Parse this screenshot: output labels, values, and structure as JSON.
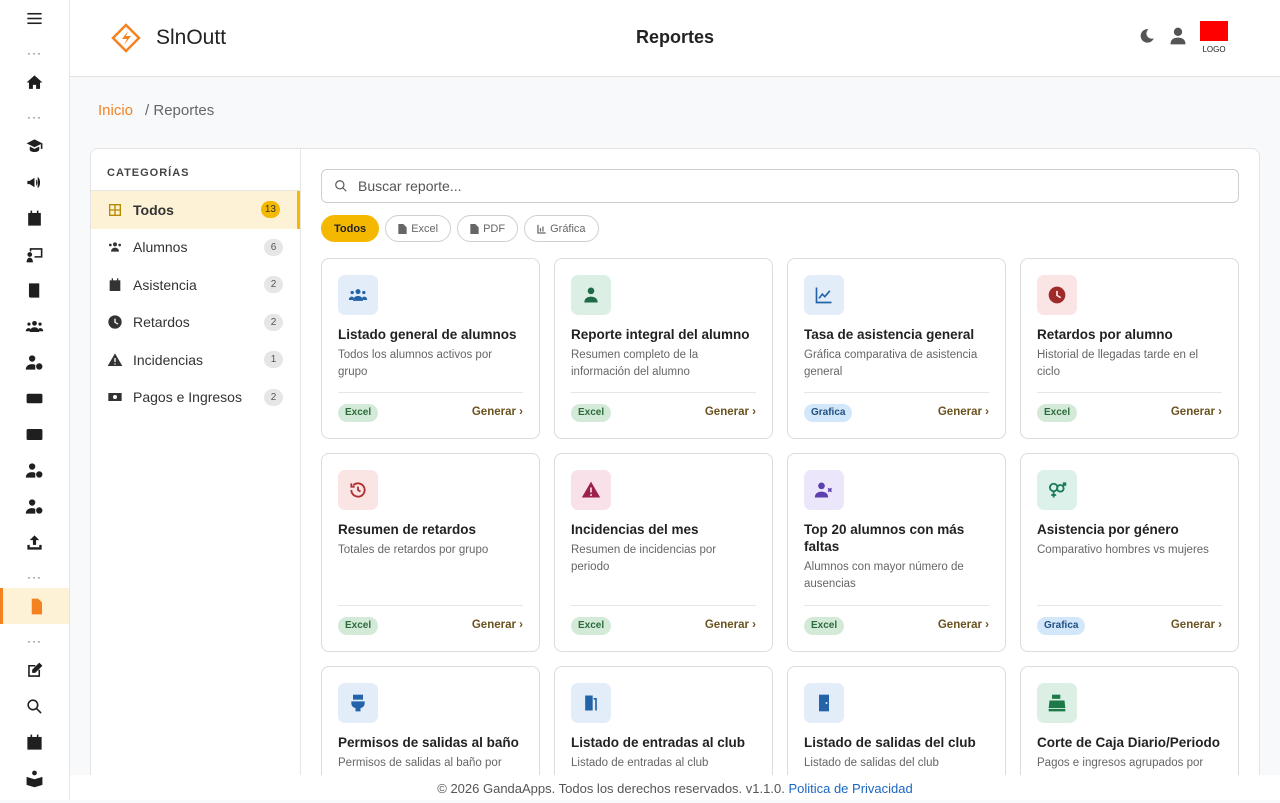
{
  "brand": {
    "name": "SlnOutt"
  },
  "page": {
    "title": "Reportes"
  },
  "logo": {
    "text": "LOGO",
    "color": "#ff0000"
  },
  "breadcrumb": {
    "home": "Inicio",
    "current": "/ Reportes"
  },
  "categories": {
    "title": "CATEGORÍAS",
    "items": [
      {
        "label": "Todos",
        "count": "13",
        "icon": "grid-icon"
      },
      {
        "label": "Alumnos",
        "count": "6",
        "icon": "users-icon"
      },
      {
        "label": "Asistencia",
        "count": "2",
        "icon": "calendar-check-icon"
      },
      {
        "label": "Retardos",
        "count": "2",
        "icon": "clock-icon"
      },
      {
        "label": "Incidencias",
        "count": "1",
        "icon": "warning-icon"
      },
      {
        "label": "Pagos e Ingresos",
        "count": "2",
        "icon": "money-icon"
      }
    ]
  },
  "search": {
    "placeholder": "Buscar reporte..."
  },
  "filters": [
    "Todos",
    "Excel",
    "PDF",
    "Gráfica"
  ],
  "cards": [
    {
      "title": "Listado general de alumnos",
      "desc": "Todos los alumnos activos por grupo",
      "badge": "Excel",
      "action": "Generar ›",
      "icon": "users-icon"
    },
    {
      "title": "Reporte integral del alumno",
      "desc": "Resumen completo de la información del alumno",
      "badge": "Excel",
      "action": "Generar ›",
      "icon": "user-icon"
    },
    {
      "title": "Tasa de asistencia general",
      "desc": "Gráfica comparativa de asistencia general",
      "badge": "Grafica",
      "action": "Generar ›",
      "icon": "line-chart-icon"
    },
    {
      "title": "Retardos por alumno",
      "desc": "Historial de llegadas tarde en el ciclo",
      "badge": "Excel",
      "action": "Generar ›",
      "icon": "clock-icon"
    },
    {
      "title": "Resumen de retardos",
      "desc": "Totales de retardos por grupo",
      "badge": "Excel",
      "action": "Generar ›",
      "icon": "history-icon"
    },
    {
      "title": "Incidencias del mes",
      "desc": "Resumen de incidencias por periodo",
      "badge": "Excel",
      "action": "Generar ›",
      "icon": "warning-icon"
    },
    {
      "title": "Top 20 alumnos con más faltas",
      "desc": "Alumnos con mayor número de ausencias",
      "badge": "Excel",
      "action": "Generar ›",
      "icon": "user-x-icon"
    },
    {
      "title": "Asistencia por género",
      "desc": "Comparativo hombres vs mujeres",
      "badge": "Grafica",
      "action": "Generar ›",
      "icon": "gender-icon"
    },
    {
      "title": "Permisos de salidas al baño",
      "desc": "Permisos de salidas al baño por",
      "icon": "toilet-icon"
    },
    {
      "title": "Listado de entradas al club",
      "desc": "Listado de entradas al club",
      "icon": "door-in-icon"
    },
    {
      "title": "Listado de salidas del club",
      "desc": "Listado de salidas del club",
      "icon": "door-out-icon"
    },
    {
      "title": "Corte de Caja Diario/Periodo",
      "desc": "Pagos e ingresos agrupados por",
      "icon": "cash-register-icon"
    }
  ],
  "footer": {
    "text": "© 2026 GandaApps. Todos los derechos reservados. v1.1.0.",
    "link": "Politica de Privacidad"
  },
  "colors": {
    "accent": "#f58220",
    "yellow": "#f5b800"
  }
}
